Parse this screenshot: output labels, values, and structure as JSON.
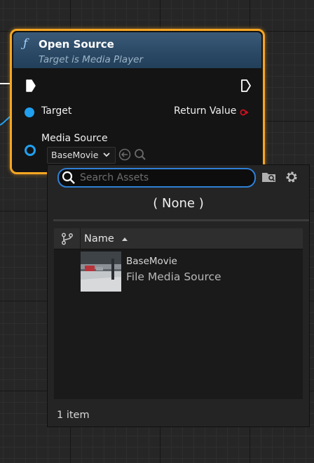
{
  "node": {
    "title": "Open Source",
    "subtitle": "Target is Media Player",
    "function_icon": "ƒ",
    "pins": {
      "target_label": "Target",
      "return_label": "Return Value",
      "media_source_label": "Media Source"
    },
    "media_source_value": "BaseMovie"
  },
  "picker": {
    "search_placeholder": "Search Assets",
    "search_value": "",
    "none_label": "( None )",
    "column_name_label": "Name",
    "assets": [
      {
        "name": "BaseMovie",
        "type": "File Media Source"
      }
    ],
    "item_count_label": "1 item"
  },
  "colors": {
    "node_border": "#f5a623",
    "header_blue": "#2a4864",
    "object_pin": "#21a0f0",
    "return_pin": "#d01020",
    "search_focus": "#2f7fd6"
  },
  "icons": [
    "function-icon",
    "exec-pin-icon",
    "object-pin-icon",
    "chevron-down-icon",
    "use-selected-icon",
    "browse-icon",
    "search-icon",
    "folder-icon",
    "gear-icon",
    "source-control-icon",
    "sort-ascending-icon"
  ]
}
